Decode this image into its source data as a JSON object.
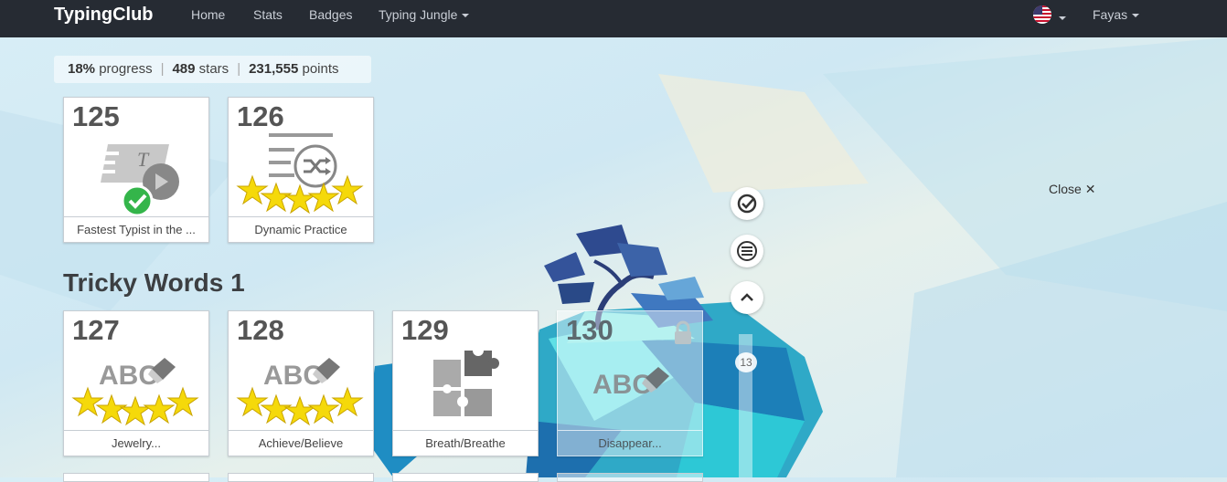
{
  "nav": {
    "brand": "TypingClub",
    "links": [
      "Home",
      "Stats",
      "Badges",
      "Typing Jungle"
    ],
    "user": "Fayas"
  },
  "stats": {
    "progress_value": "18%",
    "progress_label": "progress",
    "stars_value": "489",
    "stars_label": "stars",
    "points_value": "231,555",
    "points_label": "points"
  },
  "lessons_top": [
    {
      "num": "125",
      "label": "Fastest Typist in the ...",
      "icon": "video-play-check-icon"
    },
    {
      "num": "126",
      "label": "Dynamic Practice",
      "icon": "shuffle-text-icon",
      "stars": 5
    }
  ],
  "section": {
    "title": "Tricky Words 1"
  },
  "lessons_tricky": [
    {
      "num": "127",
      "label": "Jewelry...",
      "icon": "abc-eraser-icon",
      "stars": 5
    },
    {
      "num": "128",
      "label": "Achieve/Believe",
      "icon": "abc-eraser-icon",
      "stars": 5
    },
    {
      "num": "129",
      "label": "Breath/Breathe",
      "icon": "puzzle-icon"
    },
    {
      "num": "130",
      "label": "Disappear...",
      "icon": "abc-eraser-icon",
      "locked": true
    }
  ],
  "side": {
    "close_label": "Close",
    "scroll_badge": "13"
  },
  "colors": {
    "navbar": "#262b33",
    "star": "#f5d90a",
    "check": "#34b54a"
  }
}
